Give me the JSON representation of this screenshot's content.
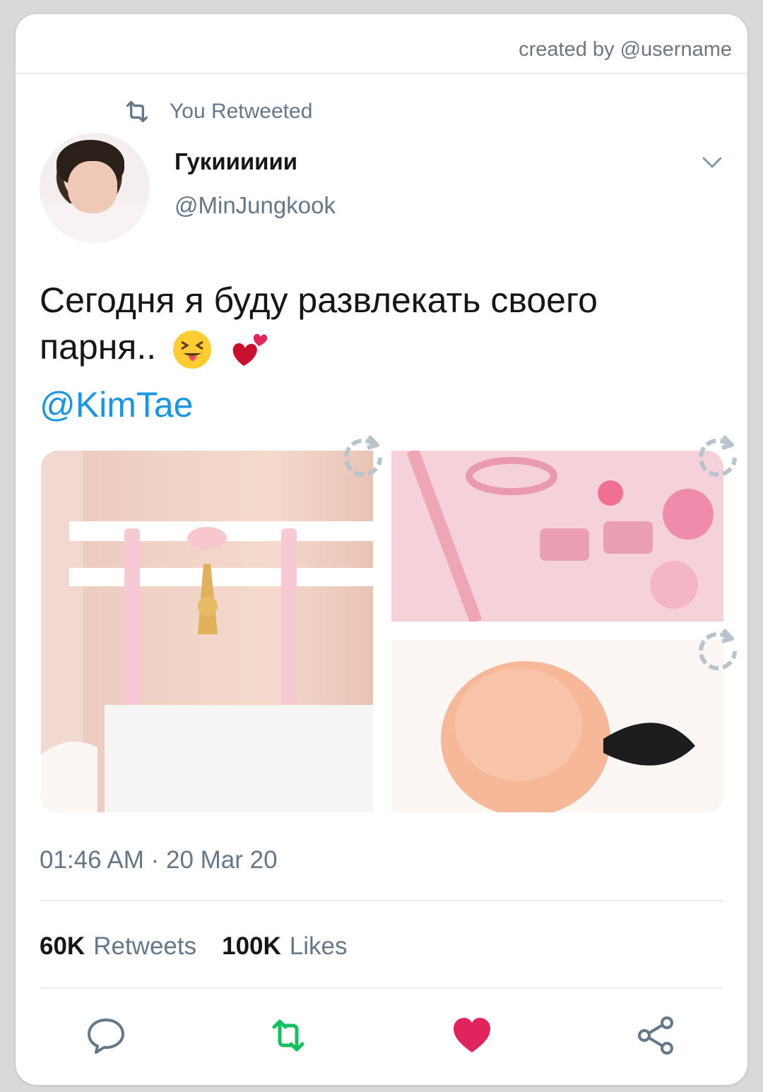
{
  "header": {
    "credit": "created by @username"
  },
  "retweet": {
    "label": "You Retweeted",
    "icon": "retweet-icon"
  },
  "author": {
    "display_name": "Гукииииии",
    "handle": "@MinJungkook"
  },
  "tweet": {
    "text": "Сегодня я буду развлекать своего парня..",
    "mention": "@KimTae",
    "emojis": [
      "squinting-tongue-emoji",
      "two-hearts-emoji"
    ]
  },
  "media": [
    "thigh-garter-photo",
    "pink-accessories-photo",
    "pink-fluffy-tail-photo"
  ],
  "meta": {
    "time": "01:46 AM · 20 Mar 20"
  },
  "stats": {
    "retweets_count": "60K",
    "retweets_label": "Retweets",
    "likes_count": "100K",
    "likes_label": "Likes"
  },
  "colors": {
    "accent": "#1b95e0",
    "retweet_green": "#17bf63",
    "like_red": "#e0245e",
    "muted": "#657786"
  },
  "actions": [
    "reply-icon",
    "retweet-icon",
    "like-icon",
    "share-icon"
  ]
}
